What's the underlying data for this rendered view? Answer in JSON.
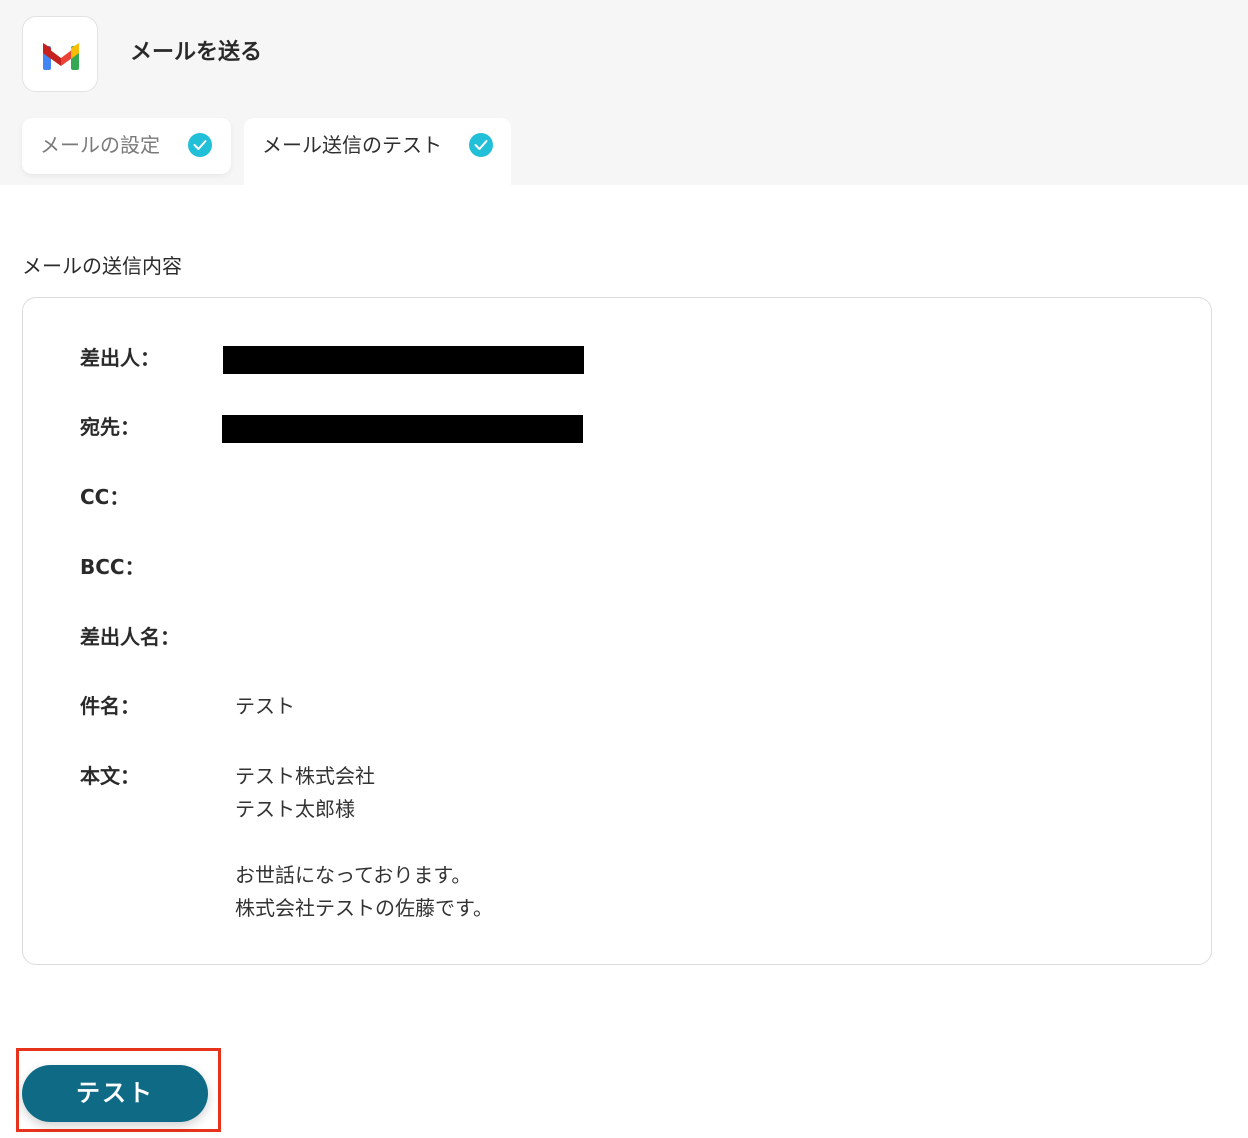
{
  "header": {
    "app_icon": "gmail-icon",
    "title": "メールを送る"
  },
  "tabs": [
    {
      "label": "メールの設定",
      "completed": true,
      "active": false
    },
    {
      "label": "メール送信のテスト",
      "completed": true,
      "active": true
    }
  ],
  "section": {
    "title": "メールの送信内容"
  },
  "fields": {
    "sender": {
      "label": "差出人：",
      "redacted": true
    },
    "to": {
      "label": "宛先：",
      "redacted": true
    },
    "cc": {
      "label": "CC：",
      "value": ""
    },
    "bcc": {
      "label": "BCC：",
      "value": ""
    },
    "sender_name": {
      "label": "差出人名：",
      "value": ""
    },
    "subject": {
      "label": "件名：",
      "value": "テスト"
    },
    "body": {
      "label": "本文：",
      "value": "テスト株式会社\nテスト太郎様\n\nお世話になっております。\n株式会社テストの佐藤です。"
    }
  },
  "actions": {
    "test_button": "テスト"
  },
  "colors": {
    "accent_check": "#22bfd8",
    "primary_button": "#0f6a86",
    "highlight": "#e8331c"
  }
}
